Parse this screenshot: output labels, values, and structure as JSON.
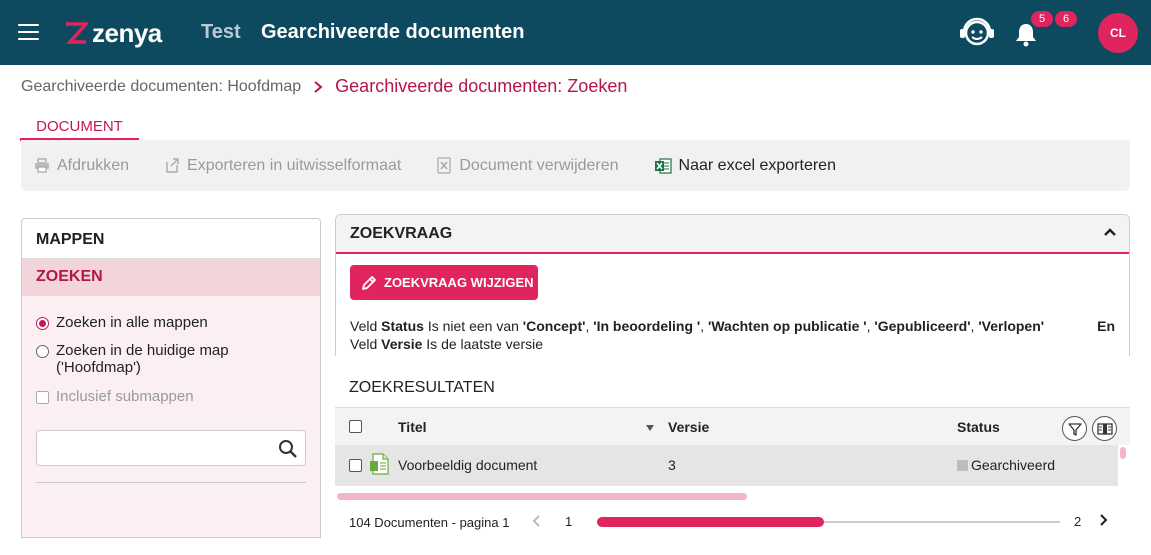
{
  "header": {
    "brand": "zenya",
    "environment": "Test",
    "title": "Gearchiveerde documenten",
    "notif_badge_1": "5",
    "notif_badge_2": "6",
    "avatar_initials": "CL"
  },
  "breadcrumb": {
    "parent": "Gearchiveerde documenten: Hoofdmap",
    "current": "Gearchiveerde documenten: Zoeken"
  },
  "ribbon": {
    "tab": "DOCUMENT",
    "buttons": {
      "print": "Afdrukken",
      "export": "Exporteren in uitwisselformaat",
      "delete": "Document verwijderen",
      "excel": "Naar excel exporteren"
    }
  },
  "left_panel": {
    "folders_header": "MAPPEN",
    "search_header": "ZOEKEN",
    "option_all": "Zoeken in alle mappen",
    "option_current": "Zoeken in de huidige map",
    "option_current_sub": "('Hoofdmap')",
    "include_subfolders": "Inclusief submappen",
    "search_value": "",
    "search_placeholder": ""
  },
  "query": {
    "header": "ZOEKVRAAG",
    "edit_button": "ZOEKVRAAG WIJZIGEN",
    "line1": {
      "prefix": "Veld ",
      "field": "Status",
      "op": " Is niet een van ",
      "v1": "'Concept'",
      "c1": ", ",
      "v2": "'In beoordeling '",
      "c2": ", ",
      "v3": "'Wachten op publicatie '",
      "c3": ", ",
      "v4": "'Gepubliceerd'",
      "c4": ", ",
      "v5": "'Verlopen'"
    },
    "conjunction": "En",
    "line2": {
      "prefix": "Veld ",
      "field": "Versie",
      "op": " Is de laatste versie"
    }
  },
  "results": {
    "title": "ZOEKRESULTATEN",
    "columns": {
      "title": "Titel",
      "version": "Versie",
      "status": "Status"
    },
    "rows": [
      {
        "title": "Voorbeeldig document",
        "version": "3",
        "status": "Gearchiveerd"
      }
    ],
    "page_count": "104 Documenten - pagina 1",
    "page_first": "1",
    "page_last": "2",
    "page_progress": 0.49
  },
  "colors": {
    "header_bg": "#0e4a5f",
    "accent": "#e0245e",
    "accent_dark": "#b5154b",
    "excel_green": "#1e7145"
  }
}
